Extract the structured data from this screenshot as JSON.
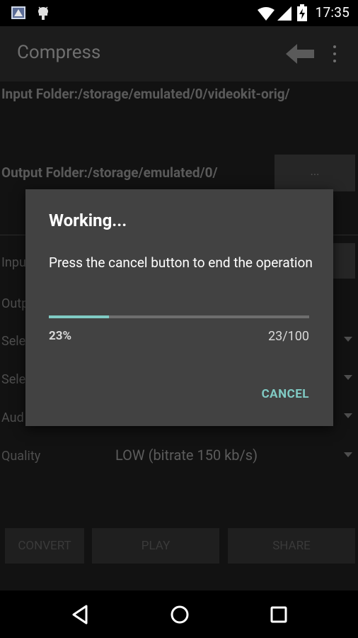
{
  "status_bar": {
    "time": "17:35",
    "icons": [
      "app-notification-icon",
      "android-debug-icon",
      "wifi-icon",
      "cell-signal-icon",
      "battery-charging-icon"
    ]
  },
  "app_bar": {
    "title": "Compress",
    "back_icon": "back-arrow-icon",
    "menu_icon": "overflow-menu-icon"
  },
  "form": {
    "input_folder": "Input Folder:/storage/emulated/0/videokit-orig/",
    "output_folder": "Output Folder:/storage/emulated/0/",
    "browse_label": "...",
    "rows": [
      {
        "label": "Inpu"
      },
      {
        "label": "Outp"
      },
      {
        "label": "Sele"
      },
      {
        "label": "Sele"
      },
      {
        "label": "Aud"
      }
    ],
    "quality_label": "Quality",
    "quality_value": "LOW (bitrate 150 kb/s)",
    "buttons": {
      "convert": "CONVERT",
      "play": "PLAY",
      "share": "SHARE"
    }
  },
  "dialog": {
    "title": "Working...",
    "message": "Press the cancel button to end the operation",
    "progress_fraction": 0.23,
    "percent_text": "23%",
    "count_text": "23/100",
    "cancel_label": "CANCEL"
  },
  "colors": {
    "accent": "#80cbc4",
    "dialog_bg": "#424242"
  },
  "nav_bar": {
    "icons": [
      "back-triangle-icon",
      "home-circle-icon",
      "recents-square-icon"
    ]
  }
}
